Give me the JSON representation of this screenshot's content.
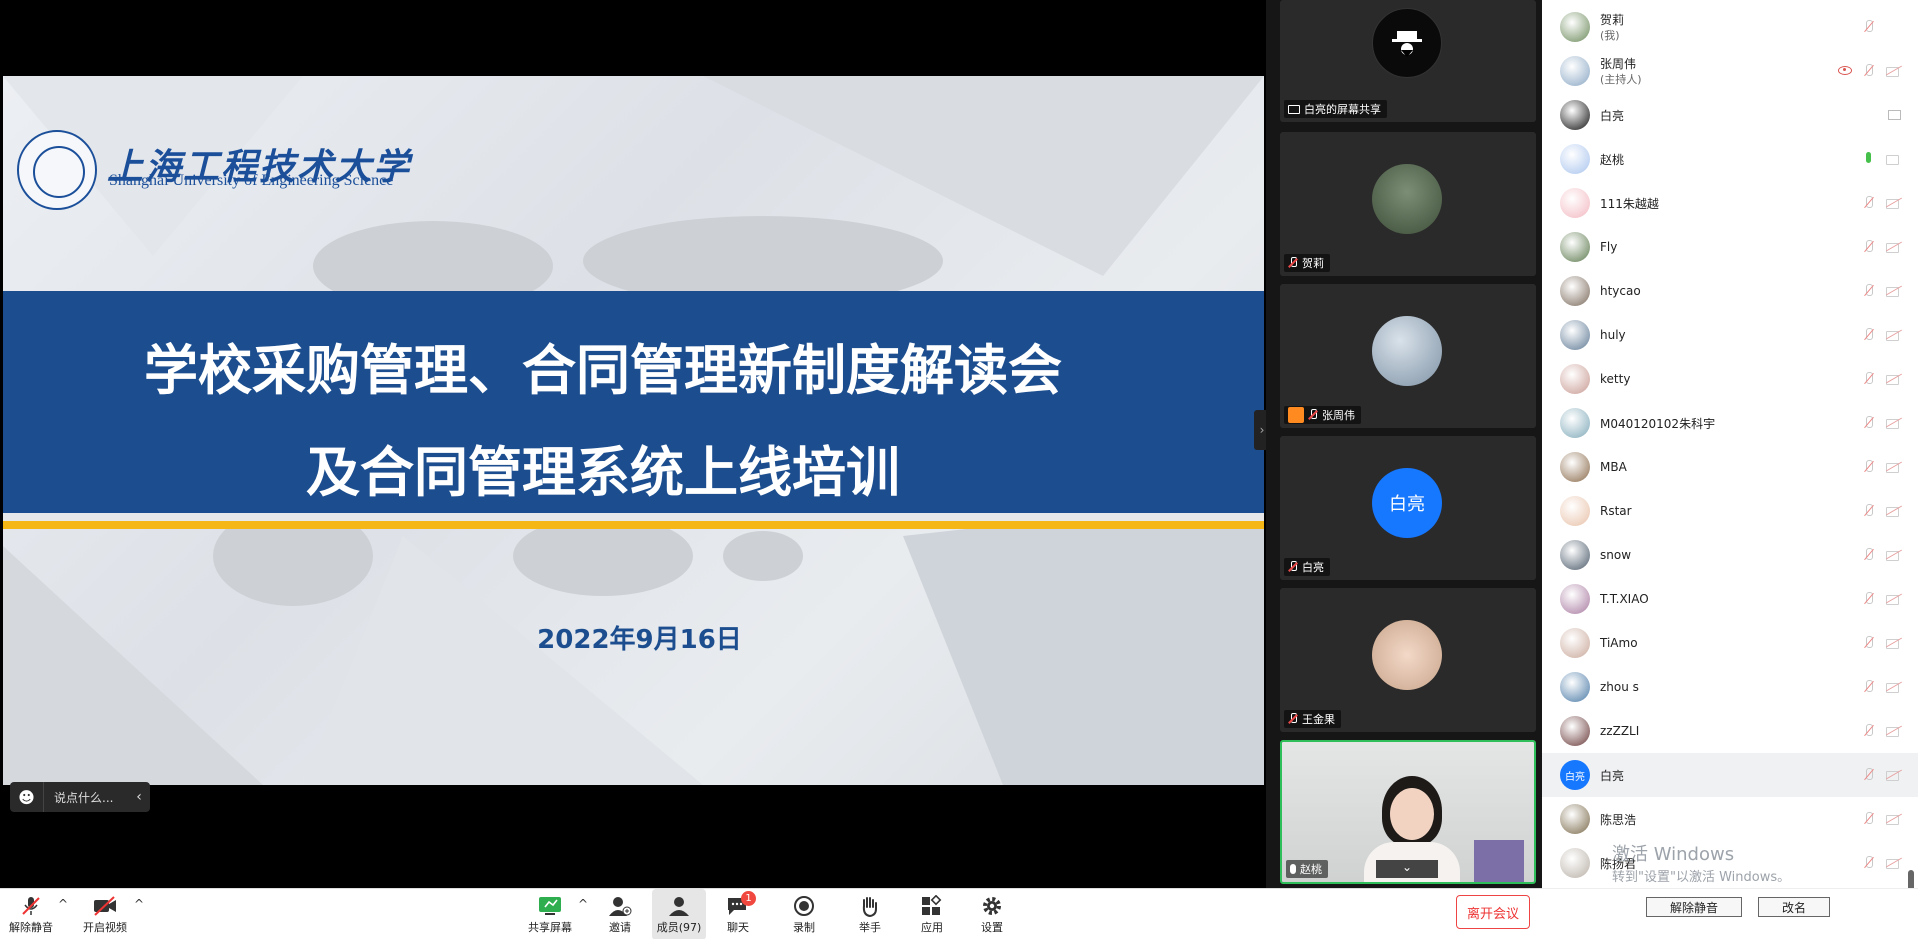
{
  "slide": {
    "logo_cn": "上海工程技术大学",
    "logo_en": "Shanghai University of Engineering Science",
    "title_line1": "学校采购管理、合同管理新制度解读会",
    "title_line2": "及合同管理系统上线培训",
    "date": "2022年9月16日"
  },
  "chat_input": {
    "placeholder": "说点什么..."
  },
  "video_tiles": [
    {
      "name": "白亮的屏幕共享",
      "avatar_type": "dark-logo"
    },
    {
      "name": "贺莉",
      "avatar_type": "photo-tree"
    },
    {
      "name": "张周伟",
      "avatar_type": "photo-sky"
    },
    {
      "name": "白亮",
      "avatar_text": "白亮",
      "avatar_color": "#1677ff"
    },
    {
      "name": "王金果",
      "avatar_type": "photo-kids"
    },
    {
      "name": "赵桃",
      "avatar_type": "live-video"
    }
  ],
  "participants": [
    {
      "name": "贺莉",
      "sub": "(我)",
      "color": "#6b8a5a"
    },
    {
      "name": "张周伟",
      "sub": "(主持人)",
      "color": "#8aa7c4"
    },
    {
      "name": "白亮",
      "color": "#111111"
    },
    {
      "name": "赵桃",
      "color": "#a9c4ee"
    },
    {
      "name": "111朱越越",
      "color": "#f2b8c0"
    },
    {
      "name": "Fly",
      "color": "#5d7a4e"
    },
    {
      "name": "htycao",
      "color": "#7b6a5b"
    },
    {
      "name": "huly",
      "color": "#5f7a95"
    },
    {
      "name": "ketty",
      "color": "#c89a92"
    },
    {
      "name": "M040120102朱科宇",
      "color": "#7fa9b8"
    },
    {
      "name": "MBA",
      "color": "#8a6a4a"
    },
    {
      "name": "Rstar",
      "color": "#e8c1a8"
    },
    {
      "name": "snow",
      "color": "#4b5a6a"
    },
    {
      "name": "T.T.XIAO",
      "color": "#a87aa0"
    },
    {
      "name": "TiAmo",
      "color": "#c9a89a"
    },
    {
      "name": "zhou s",
      "color": "#4a7aa6"
    },
    {
      "name": "zzZZLI",
      "color": "#6a3a3a"
    },
    {
      "name": "白亮",
      "avatar_text": "白亮",
      "color": "#1677ff",
      "highlight": true
    },
    {
      "name": "陈思浩",
      "color": "#7a6a4a"
    },
    {
      "name": "陈扬君",
      "color": "#b8b0a6"
    }
  ],
  "watermark": {
    "line1": "激活 Windows",
    "line2": "转到\"设置\"以激活 Windows。"
  },
  "participants_footer": {
    "unmute_all": "解除静音",
    "rename": "改名"
  },
  "toolbar": {
    "unmute": "解除静音",
    "start_video": "开启视频",
    "share_screen": "共享屏幕",
    "invite": "邀请",
    "members": "成员(97)",
    "chat": "聊天",
    "chat_badge": "1",
    "record": "录制",
    "raise_hand": "举手",
    "apps": "应用",
    "settings": "设置",
    "leave": "离开会议"
  },
  "colors": {
    "accent": "#1c4e8f",
    "gold": "#f4b716",
    "leave": "#e33333"
  }
}
